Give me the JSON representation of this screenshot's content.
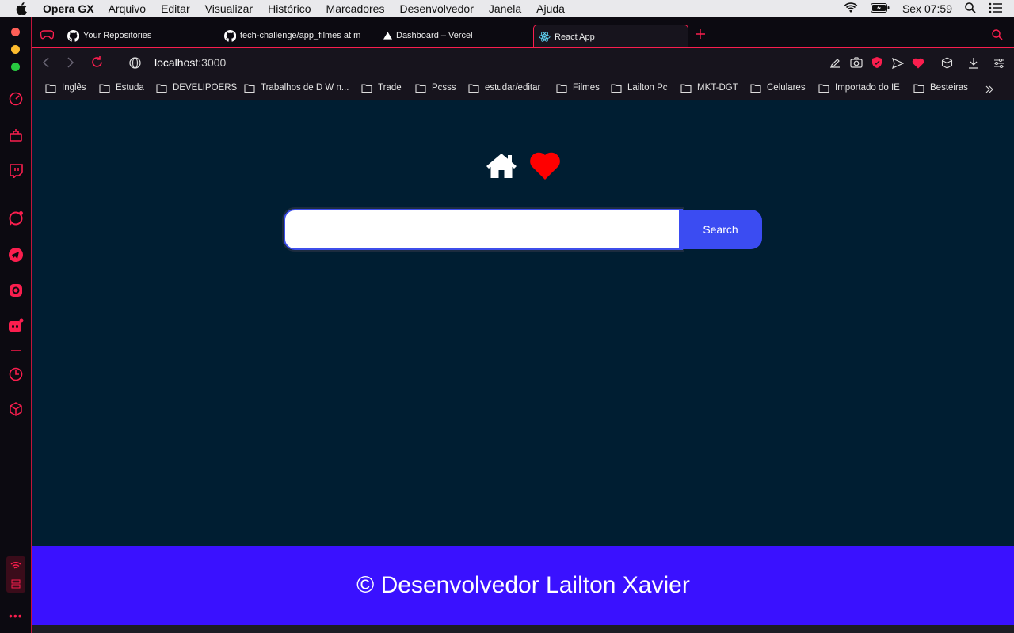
{
  "menubar": {
    "app_name": "Opera GX",
    "items": [
      "Arquivo",
      "Editar",
      "Visualizar",
      "Histórico",
      "Marcadores",
      "Desenvolvedor",
      "Janela",
      "Ajuda"
    ],
    "clock": "Sex 07:59"
  },
  "tabs": [
    {
      "label": "Your Repositories",
      "icon": "github-icon"
    },
    {
      "label": "tech-challenge/app_filmes at m",
      "icon": "github-icon"
    },
    {
      "label": "Dashboard – Vercel",
      "icon": "vercel-icon"
    },
    {
      "label": "React App",
      "icon": "react-icon",
      "active": true
    }
  ],
  "address": {
    "host": "localhost",
    "port": ":3000"
  },
  "bookmarks": [
    "Inglês",
    "Estuda",
    "DEVELIPOERS",
    "Trabalhos de D W n...",
    "Trade",
    "Pcsss",
    "estudar/editar",
    "Filmes",
    "Lailton Pc",
    "MKT-DGT",
    "Celulares",
    "Importado do IE",
    "Besteiras"
  ],
  "page": {
    "search_value": "",
    "search_button": "Search",
    "footer_text": "© Desenvolvedor Lailton Xavier"
  },
  "colors": {
    "accent": "#fa1e4e",
    "page_bg": "#001e32",
    "button": "#3b4cf2",
    "footer": "#3a11ff",
    "heart": "#ff0000"
  }
}
